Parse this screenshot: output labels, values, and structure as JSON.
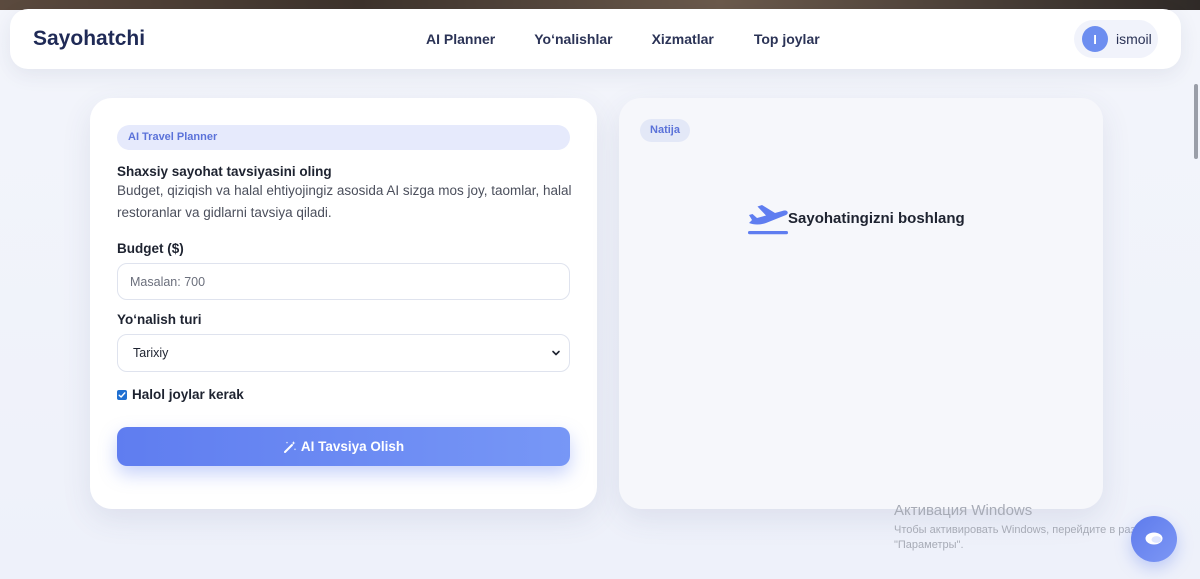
{
  "navbar": {
    "brand": "Sayohatchi",
    "links": [
      "AI Planner",
      "Yo‘nalishlar",
      "Xizmatlar",
      "Top joylar"
    ],
    "user": {
      "initial": "I",
      "name": "ismoil"
    }
  },
  "planner": {
    "badge": "AI Travel Planner",
    "title": "Shaxsiy sayohat tavsiyasini oling",
    "description": "Budget, qiziqish va halal ehtiyojingiz asosida AI sizga mos joy, taomlar, halal restoranlar va gidlarni tavsiya qiladi.",
    "budget_label": "Budget ($)",
    "budget_placeholder": "Masalan: 700",
    "budget_value": "",
    "type_label": "Yo‘nalish turi",
    "type_selected": "Tarixiy",
    "halal_label": "Halol joylar kerak",
    "halal_checked": true,
    "submit_label": "AI Tavsiya Olish"
  },
  "result": {
    "badge": "Natija",
    "empty_text": "Sayohatingizni boshlang"
  },
  "windows_watermark": {
    "title": "Активация Windows",
    "subtitle": "Чтобы активировать Windows, перейдите в раздел \"Параметры\"."
  },
  "icons": {
    "plane": "plane-departure-icon",
    "wand": "magic-wand-icon",
    "chat": "chat-bubble-icon",
    "chevron": "chevron-down-icon"
  },
  "colors": {
    "brand": "#1f2a56",
    "accent": "#5f7df0",
    "badge_bg": "#e6eafc"
  }
}
